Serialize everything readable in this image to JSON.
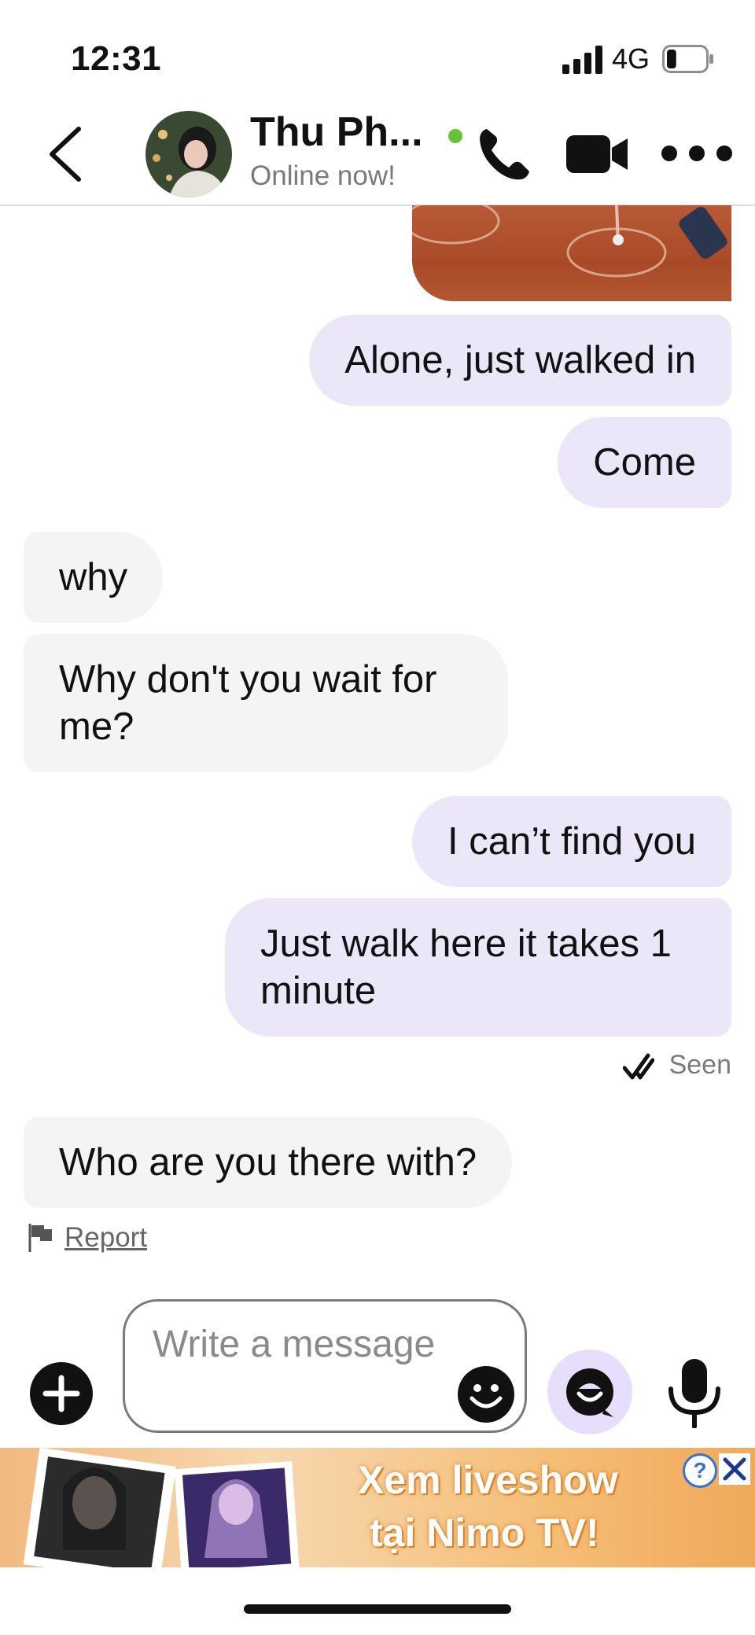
{
  "status_bar": {
    "time": "12:31",
    "network": "4G",
    "battery_level": 0.25
  },
  "header": {
    "name": "Thu Ph...",
    "status": "Online now!",
    "online_color": "#67c23a"
  },
  "messages": [
    {
      "from": "me",
      "text": "Alone, just walked in"
    },
    {
      "from": "me",
      "text": "Come"
    },
    {
      "from": "them",
      "text": "why"
    },
    {
      "from": "them",
      "text": "Why don't you wait for me?"
    },
    {
      "from": "me",
      "text": "I can’t find you"
    },
    {
      "from": "me",
      "text": "Just walk here it takes 1 minute"
    },
    {
      "from": "them",
      "text": "Who are you there with?"
    }
  ],
  "seen_label": "Seen",
  "report_label": "Report",
  "composer": {
    "placeholder": "Write a message"
  },
  "ad": {
    "line1": "Xem liveshow",
    "line2": "tại Nimo TV!",
    "help": "?"
  },
  "colors": {
    "outgoing_bubble": "#ebe6f8",
    "incoming_bubble": "#f4f4f4",
    "accent": "#e6defa"
  },
  "icons": [
    "back-chevron-icon",
    "phone-icon",
    "video-camera-icon",
    "more-dots-icon",
    "double-check-icon",
    "flag-icon",
    "plus-icon",
    "emoji-icon",
    "sticker-icon",
    "microphone-icon",
    "help-icon",
    "close-icon"
  ]
}
